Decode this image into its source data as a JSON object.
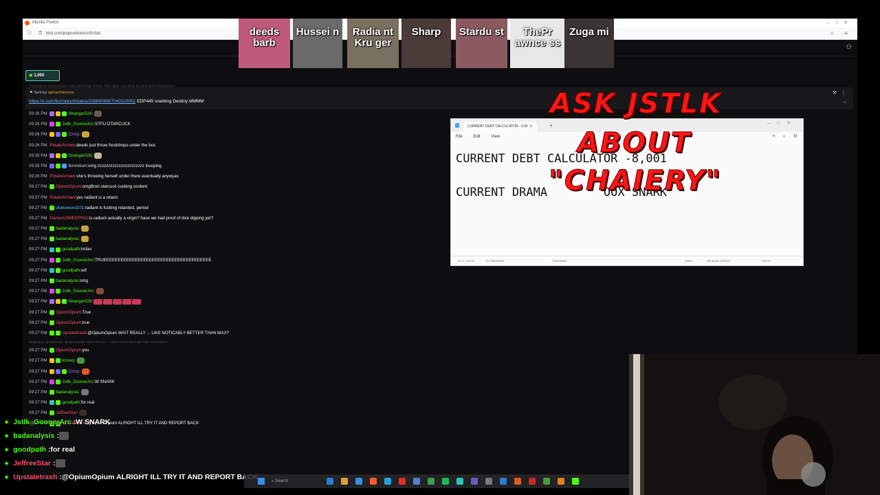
{
  "browser": {
    "title": "Mozilla Firefox",
    "url": "kick.com/popout/dariusirl/chat"
  },
  "chat": {
    "goal_value": "1,000",
    "reply_banner": "Replying to Upstatetrash: HAS ANYONE TRIED THE NEW GOLDEN BLUECHEW PACKAGE?",
    "pinned": {
      "sent_by_label": "Sent by",
      "sent_by_user": "alphanthinroom",
      "link": "https://x.com/korzawyd/status/2086606657040110051",
      "text": "EDP445 snarking Destiny MMMM"
    },
    "messages": [
      {
        "time": "09:26 PM",
        "user": "Stranger526",
        "color": "#53fc18",
        "text": "",
        "badges": [
          "#a86cff",
          "#f5c518",
          "#53fc18"
        ],
        "emote": "#6b5a4a"
      },
      {
        "time": "09:26 PM",
        "user": "Jstlk_GoonerArc",
        "color": "#53fc18",
        "text": "STFU DTARCUCK",
        "badges": [
          "#e040fb",
          "#53fc18"
        ]
      },
      {
        "time": "09:26 PM",
        "user": "Zzorp",
        "color": "#a970ff",
        "text": "",
        "badges": [
          "#f5c518",
          "#7b61ff",
          "#53fc18"
        ],
        "emote": "#c8a33a"
      },
      {
        "time": "09:26 PM",
        "user": "PotatoArrows",
        "color": "#ff4f6d",
        "text": "deeds just throw foodshops under the bus",
        "badges": []
      },
      {
        "time": "09:26 PM",
        "user": "Stranger526",
        "color": "#53fc18",
        "text": "",
        "badges": [
          "#a86cff",
          "#f5c518",
          "#53fc18"
        ],
        "emote": "#c8b89a"
      },
      {
        "time": "09:26 PM",
        "user": "fernreturn",
        "color": "#d8d8d8",
        "text": "omg zzzzzzzzzzzzzzzzzzzzzz loooping",
        "badges": [
          "#7b61ff",
          "#53fc18",
          "#4aa3ff"
        ]
      },
      {
        "time": "09:26 PM",
        "user": "PotatoArrows",
        "color": "#ff4f6d",
        "text": "she's throwing herself under there eventually anywyas",
        "badges": []
      },
      {
        "time": "09:27 PM",
        "user": "OpiumOpium",
        "color": "#ff4f6d",
        "text": "omgBruh starcuck cucking content",
        "badges": [
          "#53fc18"
        ]
      },
      {
        "time": "09:27 PM",
        "user": "PotatoArrows",
        "color": "#ff4f6d",
        "text": "yes radiant is a retard",
        "badges": []
      },
      {
        "time": "09:27 PM",
        "user": "drakewood101",
        "color": "#4fc3f7",
        "text": "radiant is fucking retarded, period",
        "badges": [
          "#53fc18"
        ]
      },
      {
        "time": "09:27 PM",
        "user": "DariusisSWEEPING",
        "color": "#ff4f6d",
        "text": "is radiant actually a virgin? have we had proof of dick dipping yet?",
        "badges": []
      },
      {
        "time": "09:27 PM",
        "user": "badanalysis",
        "color": "#53fc18",
        "text": "",
        "badges": [
          "#53fc18"
        ],
        "emote": "#c8a33a"
      },
      {
        "time": "09:27 PM",
        "user": "badanalysis",
        "color": "#53fc18",
        "text": "",
        "badges": [
          "#53fc18"
        ],
        "emote": "#c8a33a"
      },
      {
        "time": "09:27 PM",
        "user": "goodpath",
        "color": "#53fc18",
        "text": "lmfao",
        "badges": [
          "#2ec4b6",
          "#53fc18"
        ]
      },
      {
        "time": "09:27 PM",
        "user": "Jstlk_GoonerArc",
        "color": "#53fc18",
        "text": "TRUEEEEEEEEEEEEEEEEEEEEEEEEEEEEEEEEEEEEEE",
        "badges": [
          "#e040fb",
          "#53fc18"
        ]
      },
      {
        "time": "09:27 PM",
        "user": "goodpath",
        "color": "#53fc18",
        "text": "wtf",
        "badges": [
          "#2ec4b6",
          "#53fc18"
        ]
      },
      {
        "time": "09:27 PM",
        "user": "badanalysis",
        "color": "#53fc18",
        "text": "omg",
        "badges": [
          "#53fc18"
        ]
      },
      {
        "time": "09:27 PM",
        "user": "Jstlk_GoonerArc",
        "color": "#53fc18",
        "text": "",
        "badges": [
          "#e040fb",
          "#53fc18"
        ],
        "emote": "#8a4a3a"
      },
      {
        "time": "09:27 PM",
        "user": "Stranger526",
        "color": "#53fc18",
        "text": "",
        "badges": [
          "#a86cff",
          "#f5c518",
          "#53fc18"
        ],
        "tiles": 5
      },
      {
        "time": "09:27 PM",
        "user": "OpiumOpium",
        "color": "#ff4f6d",
        "text": "True",
        "badges": [
          "#53fc18"
        ]
      },
      {
        "time": "09:27 PM",
        "user": "OpiumOpium",
        "color": "#ff4f6d",
        "text": "true",
        "badges": [
          "#53fc18"
        ]
      },
      {
        "time": "09:27 PM",
        "user": "Upstatetrash",
        "color": "#ff4f6d",
        "text": "@OpiumOpium WAIT REALLY ... LIKE NOTICABLY BETTER THAN MAX?",
        "badges": [
          "#53fc18",
          "#53fc18"
        ]
      },
      {
        "reply": "Replying to Upstatetrash: @OpiumOpium WAIT REALLY ... LIKE NOTICABLY BETTER THAN MAX?"
      },
      {
        "time": "09:27 PM",
        "user": "OpiumOpium",
        "color": "#ff4f6d",
        "text": "yes",
        "badges": [
          "#53fc18"
        ]
      },
      {
        "time": "09:27 PM",
        "user": "krovvy",
        "color": "#53fc18",
        "text": "",
        "badges": [
          "#f5c518",
          "#53fc18"
        ],
        "emote": "#4a9a3a"
      },
      {
        "time": "09:27 PM",
        "user": "Zzorp",
        "color": "#a970ff",
        "text": "",
        "badges": [
          "#f5c518",
          "#7b61ff",
          "#53fc18"
        ],
        "emote": "#e05a2a"
      },
      {
        "time": "09:27 PM",
        "user": "Jstlk_GoonerArc",
        "color": "#53fc18",
        "text": "W SNARK",
        "badges": [
          "#e040fb",
          "#53fc18"
        ]
      },
      {
        "time": "09:27 PM",
        "user": "badanalysis",
        "color": "#53fc18",
        "text": "",
        "badges": [
          "#53fc18"
        ],
        "emote": "#777777"
      },
      {
        "time": "09:27 PM",
        "user": "goodpath",
        "color": "#53fc18",
        "text": "for real",
        "badges": [
          "#2ec4b6",
          "#53fc18"
        ]
      },
      {
        "time": "09:27 PM",
        "user": "JeffreeStar",
        "color": "#ff4f6d",
        "text": "",
        "badges": [
          "#53fc18"
        ],
        "emote": "#3a2a2a"
      },
      {
        "time": "09:27 PM",
        "user": "Upstatetrash",
        "color": "#ff4f6d",
        "text": "@OpiumOpium ALRIGHT ILL TRY IT AND REPORT BACK",
        "badges": [
          "#53fc18",
          "#53fc18"
        ]
      }
    ]
  },
  "notepad": {
    "tab_title": "CURRENT DEBT CALCULATOR - 8,00",
    "menu": [
      "File",
      "Edit",
      "View"
    ],
    "line1": "CURRENT DEBT CALCULATOR -8,001",
    "line2": "CURRENT DRAMA        OOX SNARK",
    "status": {
      "position": "Ln 1, Col 31",
      "chars": "70 characters",
      "format": "Formatted",
      "zoom": "200%",
      "eol": "Windows (CRLF)",
      "encoding": "UTF-8"
    }
  },
  "overlay_text": {
    "line1": "ASK JSTLK",
    "line2": "ABOUT",
    "line3": "\"CHAIERY\""
  },
  "cams": [
    {
      "name": "deeds barb",
      "color": "#c05a7a"
    },
    {
      "name": "Hussei n",
      "color": "#6a6a6a"
    },
    {
      "name": "Radia nt Kru ger",
      "color": "#7a7060"
    },
    {
      "name": "Sharp",
      "color": "#4a3a38"
    },
    {
      "name": "Stardu st",
      "color": "#8a5a60"
    },
    {
      "name": "ThePr awnce ss",
      "color": "#e8e8e8"
    },
    {
      "name": "Zuga mi",
      "color": "#3a3432"
    }
  ],
  "overlay_chat": [
    {
      "user": "Jstlk_GoonerArc",
      "color": "#53fc18",
      "text": "W SNARK"
    },
    {
      "user": "badanalysis",
      "color": "#53fc18",
      "text": ""
    },
    {
      "user": "goodpath",
      "color": "#53fc18",
      "text": "for real"
    },
    {
      "user": "JeffreeStar",
      "color": "#ff4f6d",
      "text": ""
    },
    {
      "user": "Upstatetrash",
      "color": "#ff4f6d",
      "text": "@OpiumOpium ALRIGHT ILL TRY IT AND REPORT BACK"
    }
  ],
  "taskbar": {
    "search_placeholder": "Search",
    "icon_colors": [
      "#2a7fd4",
      "#e0a030",
      "#3a8ee6",
      "#ff5a2a",
      "#2aa0e0",
      "#e82a2a",
      "#5a7ad8",
      "#3aa050",
      "#1db954",
      "#2ec4b6",
      "#6a5acd",
      "#7a7a7a",
      "#2a7fd4",
      "#e05a2a",
      "#c82a2a",
      "#4a9a3a",
      "#e08020",
      "#53fc18"
    ]
  }
}
